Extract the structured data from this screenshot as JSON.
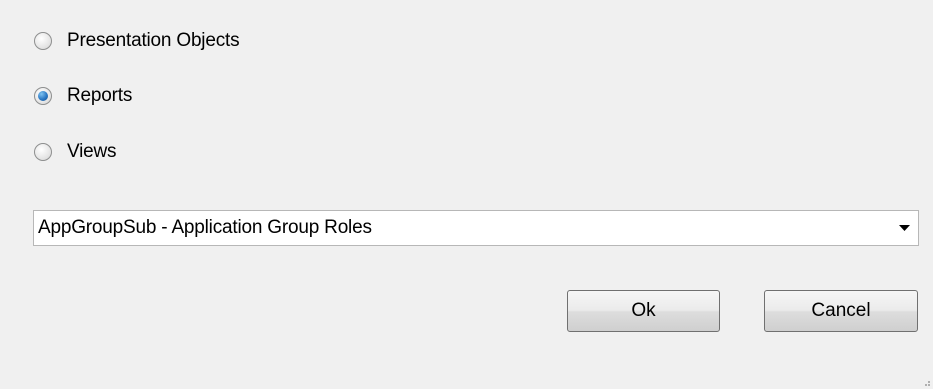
{
  "options": [
    {
      "label": "Presentation Objects",
      "checked": false
    },
    {
      "label": "Reports",
      "checked": true
    },
    {
      "label": "Views",
      "checked": false
    }
  ],
  "combo": {
    "selected_value": "AppGroupSub - Application Group Roles"
  },
  "buttons": {
    "ok_label": "Ok",
    "cancel_label": "Cancel"
  }
}
